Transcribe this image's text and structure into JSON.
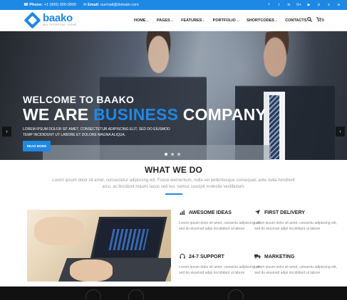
{
  "topbar": {
    "phone_label": "Phone:",
    "phone": "+1 (900) 000-0000",
    "email_label": "Email:",
    "email": "ourmail@domain.com",
    "social_icons": [
      "facebook-icon",
      "twitter-icon",
      "linkedin-icon",
      "google-plus-icon",
      "youtube-icon",
      "pinterest-icon",
      "skype-icon",
      "rss-icon"
    ]
  },
  "header": {
    "logo_name": "baako",
    "logo_tagline": "MULTIPURPOSE THEME",
    "nav": [
      {
        "label": "HOME",
        "dropdown": true
      },
      {
        "label": "PAGES",
        "dropdown": true
      },
      {
        "label": "FEATURES",
        "dropdown": true
      },
      {
        "label": "PORTFOLIO",
        "dropdown": true
      },
      {
        "label": "SHORTCODES",
        "dropdown": true
      },
      {
        "label": "CONTACTS",
        "dropdown": false
      }
    ],
    "cart_count": "0"
  },
  "hero": {
    "welcome": "WELCOME TO BAAKO",
    "headline_part1": "WE ARE",
    "headline_accent": "BUSINESS",
    "headline_part2": "COMPANY",
    "subtitle": "LOREM IPSUM DOLOR SIT AMET, CONSECTETUR ADIPISCING ELIT, SED DO EIUSMOD TEMP INCIDIDUNT UT LABORE ET DOLORE MAGNA ALIQUA.",
    "button_label": "READ MORE",
    "slide_dots": 3,
    "active_dot": 0
  },
  "what_we_do": {
    "title": "WHAT WE DO",
    "text": "Lorem ipsum dolor sit amet, consectetur adipiscing elit. Fusce elementum, nulla vel pellentesque consequat, ante nulla hendrerit arcu, ac tincidunt mauris lacus sed leo. vamus suscipit molestie vestibulum."
  },
  "features": [
    {
      "icon": "bar-chart-icon",
      "title": "AWESOME IDEAS",
      "text": "Lorem ipsum dolor sit amet, consectu adipiscing elit, sed do eiusmod adipi rincididunt ut labore"
    },
    {
      "icon": "paper-plane-icon",
      "title": "FIRST DELIVERY",
      "text": "Lorem ipsum dolor sit amet, consectu adipiscing elit, sed do eiusmod adipi rincididunt ut labore"
    },
    {
      "icon": "headphones-icon",
      "title": "24-7 SUPPORT",
      "text": "Lorem ipsum dolor sit amet, consectu adipiscing elit, sed do eiusmod adipi rincididunt ut labore"
    },
    {
      "icon": "truck-icon",
      "title": "MARKETING",
      "text": "Lorem ipsum dolor sit amet, consectu adipiscing elit, sed do eiusmod adipi rincididunt ut labore"
    }
  ],
  "colors": {
    "accent": "#1e88e5",
    "topbar": "#1e88e5",
    "dark": "#111111"
  }
}
